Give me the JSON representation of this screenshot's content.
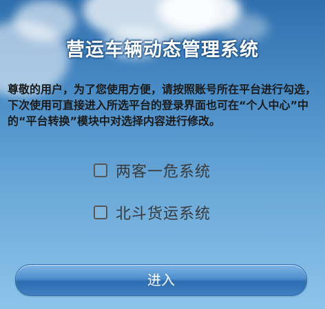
{
  "header": {
    "title": "营运车辆动态管理系统"
  },
  "main": {
    "notice": "尊敬的用户，为了您使用方便，请按照账号所在平台进行勾选，下次使用可直接进入所选平台的登录界面也可在“个人中心”中的“平台转换”模块中对选择内容进行修改。",
    "options": [
      {
        "label": "两客一危系统",
        "checked": false
      },
      {
        "label": "北斗货运系统",
        "checked": false
      }
    ],
    "enter_label": "进入"
  },
  "colors": {
    "sky_top": "#2f6fae",
    "sky_bottom": "#8cc4ea",
    "button": "#3f7fc0"
  }
}
